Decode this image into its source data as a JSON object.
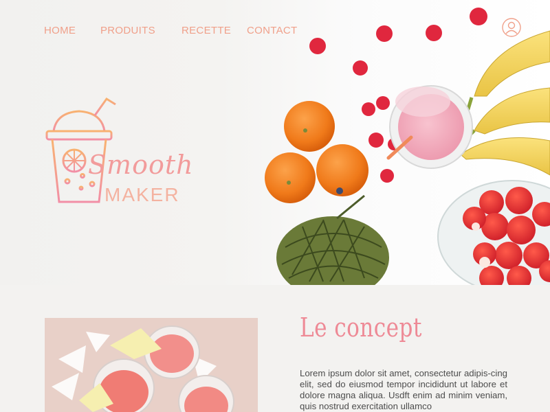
{
  "nav": {
    "items": [
      {
        "label": "HOME"
      },
      {
        "label": "PRODUITS"
      },
      {
        "label": "RECETTE"
      },
      {
        "label": "CONTACT"
      }
    ],
    "user_icon": "user-icon"
  },
  "logo": {
    "line1": "Smooth",
    "line2": "MAKER",
    "icon": "smoothie-cup-icon"
  },
  "concept": {
    "title": "Le concept",
    "text": "Lorem ipsum dolor sit amet, consectetur adipis-cing elit, sed do eiusmod tempor incididunt ut labore et dolore magna aliqua. Usdft enim ad minim veniam, quis nostrud exercitation ullamco"
  },
  "colors": {
    "nav": "#f0a08a",
    "title": "#ee8a96",
    "body_text": "#4c4c4c",
    "background": "#f3f2f0"
  }
}
